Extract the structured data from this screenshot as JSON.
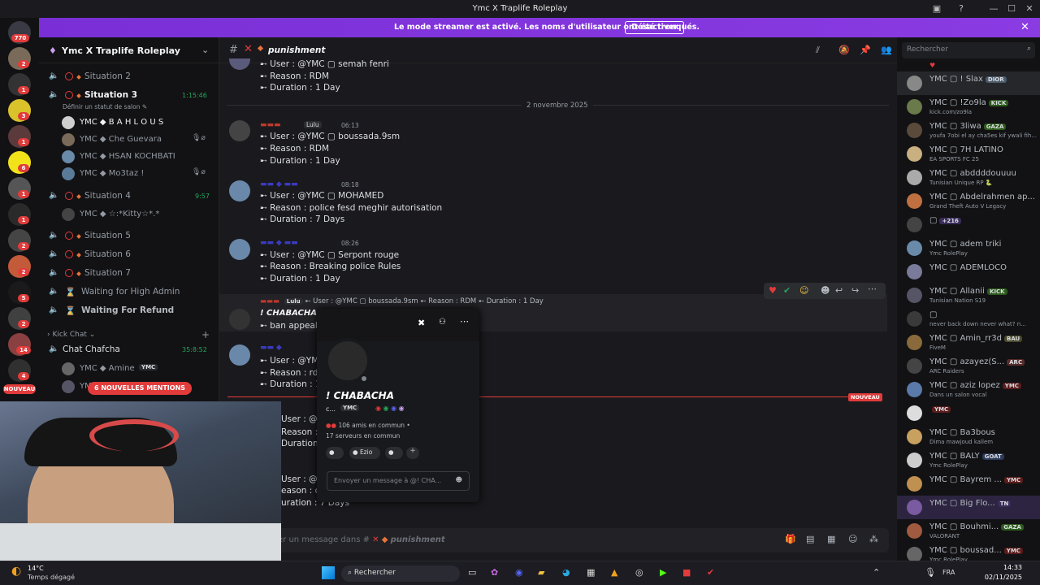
{
  "titlebar": {
    "title": "Ymc X Traplife Roleplay"
  },
  "banner": {
    "text": "Le mode streamer est activé. Les noms d'utilisateur ont été tronqués.",
    "button": "Désactiver"
  },
  "guilds": {
    "top_badge": "770",
    "badges": [
      "2",
      "1",
      "3",
      "1",
      "6",
      "1",
      "1",
      "2",
      "2",
      "5",
      "2",
      "14",
      "4"
    ],
    "new_label": "NOUVEAU"
  },
  "server": {
    "name": "Ymc X Traplife Roleplay"
  },
  "channels": [
    {
      "label": "Situation 2"
    },
    {
      "label": "Situation 3",
      "active": true,
      "time": "1:15:46",
      "status": "Définir un statut de salon ✎"
    },
    {
      "label": "Situation 4",
      "time": "9:57"
    },
    {
      "label": "Situation 5"
    },
    {
      "label": "Situation 6"
    },
    {
      "label": "Situation 7"
    },
    {
      "label": "Waiting for High Admin"
    },
    {
      "label": "Waiting For Refund"
    }
  ],
  "voice_members_s3": [
    {
      "label": "YMC ◆ B A H L O U S"
    },
    {
      "label": "YMC ◆ Che Guevara"
    },
    {
      "label": "YMC ◆ HSAN KOCHBATI"
    },
    {
      "label": "YMC ◆ Mo3taz !"
    }
  ],
  "voice_members_s4": [
    {
      "label": "YMC ◆ ☆:*Kitty☆*.*"
    }
  ],
  "kick_category": "Kick Chat",
  "kick_channel": {
    "label": "Chat Chafcha",
    "time": "35:8:52"
  },
  "kick_members": [
    {
      "label": "YMC ◆ Amine",
      "tag": "YMC"
    },
    {
      "label": "YM"
    }
  ],
  "mentions_pill": "6 NOUVELLES MENTIONS",
  "channel_header": {
    "name": "punishment",
    "search_placeholder": "Rechercher"
  },
  "messages": {
    "top": [
      {
        "text": "➸ User : @YMC ▢ semah fenri"
      },
      {
        "text": "➸ Reason : RDM"
      },
      {
        "text": "➸ Duration : 1 Day"
      }
    ],
    "date_divider": "2 novembre 2025",
    "m1": {
      "role": "Lulu",
      "time": "06:13",
      "lines": [
        "➸ User : @YMC ▢ boussada.9sm",
        "➸ Reason : RDM",
        "➸ Duration : 1 Day"
      ]
    },
    "m2": {
      "time": "08:18",
      "lines": [
        "➸ User : @YMC ▢ MOHAMED",
        "➸ Reason : police fesd meghir autorisation",
        "➸ Duration : 7 Days"
      ]
    },
    "m3": {
      "time": "08:26",
      "lines": [
        "➸ User : @YMC ▢ Serpont rouge",
        "➸ Reason :  Breaking police Rules",
        "➸ Duration : 1 Day"
      ]
    },
    "reply": {
      "role": "Lulu",
      "text": "➸ User : @YMC ▢ boussada.9sm ➸ Reason : RDM ➸ Duration : 1 Day"
    },
    "m4": {
      "author": "! CHABACHA",
      "lines": [
        "➸ ban appeal a"
      ]
    },
    "m5": {
      "lines": [
        "➸ User : @YMC",
        "➸ Reason : rdm",
        "➸ Duration : 1 D"
      ]
    },
    "new_divider": "NOUVEAU",
    "m6": {
      "lines": [
        "User : @YMC",
        "Reason : altf",
        "Duration : 7 D"
      ]
    },
    "m7": {
      "lines": [
        "User : @YMC",
        "eason : disr",
        "uration : 7 Days"
      ]
    }
  },
  "composer": {
    "placeholder": "er un message dans #",
    "channel": "punishment"
  },
  "profile": {
    "name": "! CHABACHA",
    "sub": "c...",
    "tag": "YMC",
    "friends": "106 amis en commun",
    "servers": "17 serveurs en commun",
    "chips": [
      "",
      "Ezio",
      ""
    ],
    "message_placeholder": "Envoyer un message à @! CHA..."
  },
  "member_list": [
    {
      "name": "YMC ▢ ! Slax",
      "tag": "DIOR"
    },
    {
      "name": "YMC ▢ !Zo9la",
      "tag": "KICK",
      "sub": "kick.com/zo9la"
    },
    {
      "name": "YMC ▢ 3liwa",
      "tag": "GAZA",
      "sub": "youfa 7obi el ay cha5es kif ywali fih..."
    },
    {
      "name": "YMC ▢ 7H LATINO",
      "sub": "EA SPORTS FC 25"
    },
    {
      "name": "YMC ▢ abddddouuuu",
      "sub": "Tunisian Unique RP 🐍"
    },
    {
      "name": "YMC ▢ Abdelrahmen ap...",
      "sub": "Grand Theft Auto V Legacy"
    },
    {
      "name": "▢",
      "tag": "+216"
    },
    {
      "name": "YMC ▢ adem triki",
      "sub": "Ymc RolePlay"
    },
    {
      "name": "YMC ▢ ADEMLOCO"
    },
    {
      "name": "YMC ▢ Allanii",
      "tag": "KICK",
      "sub": "Tunisian Nation S19"
    },
    {
      "name": "▢",
      "sub": "never back down never what? n..."
    },
    {
      "name": "YMC ▢ Amin_rr3d",
      "tag": "BAU",
      "sub": "FiveM"
    },
    {
      "name": "YMC ▢ azayez(S...",
      "tag": "ARC",
      "sub": "ARC Raiders"
    },
    {
      "name": "YMC ▢ aziz lopez",
      "tag": "YMC",
      "sub": "Dans un salon vocal"
    },
    {
      "name": "",
      "tag": "YMC"
    },
    {
      "name": "YMC ▢ Ba3bous",
      "sub": "Dima mawjoud kallem"
    },
    {
      "name": "YMC ▢ BALY",
      "tag": "GOAT",
      "sub": "Ymc RolePlay"
    },
    {
      "name": "YMC ▢ Bayrem ...",
      "tag": "YMC"
    },
    {
      "name": "YMC ▢ Big Flo...",
      "tag": "TN"
    },
    {
      "name": "YMC ▢ Bouhmi...",
      "tag": "GAZA",
      "sub": "VALORANT"
    },
    {
      "name": "YMC ▢ boussad...",
      "tag": "YMC",
      "sub": "Ymc RolePlay"
    }
  ],
  "taskbar": {
    "weather_temp": "14°C",
    "weather_desc": "Temps dégagé",
    "search": "Rechercher",
    "lang": "FRA",
    "time": "14:33",
    "date": "02/11/2025"
  },
  "colors": {
    "accent": "#5865f2",
    "banner": "#8a3be2",
    "danger": "#e23b3b",
    "online": "#23a55a"
  }
}
